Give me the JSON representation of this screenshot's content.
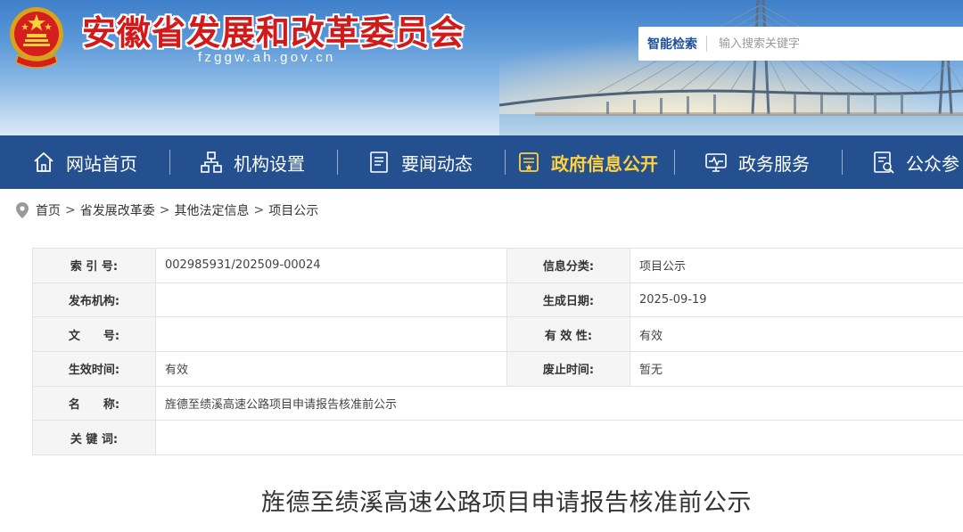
{
  "header": {
    "site_title": "安徽省发展和改革委员会",
    "site_domain": "fzggw.ah.gov.cn",
    "emblem_icon": "national-emblem-icon",
    "search": {
      "label": "智能检索",
      "placeholder": "输入搜索关键字"
    }
  },
  "nav": {
    "items": [
      {
        "label": "网站首页",
        "icon": "home-icon",
        "active": false
      },
      {
        "label": "机构设置",
        "icon": "org-chart-icon",
        "active": false
      },
      {
        "label": "要闻动态",
        "icon": "news-icon",
        "active": false
      },
      {
        "label": "政府信息公开",
        "icon": "info-disclosure-icon",
        "active": true
      },
      {
        "label": "政务服务",
        "icon": "service-icon",
        "active": false
      },
      {
        "label": "公众参",
        "icon": "public-participation-icon",
        "active": false
      }
    ]
  },
  "breadcrumb": {
    "items": [
      "首页",
      "省发展改革委",
      "其他法定信息",
      "项目公示"
    ],
    "separator": ">"
  },
  "meta_table": {
    "index_label": "索 引 号:",
    "index_value": "002985931/202509-00024",
    "category_label": "信息分类:",
    "category_value": "项目公示",
    "publisher_label": "发布机构:",
    "publisher_value": "",
    "date_label": "生成日期:",
    "date_value": "2025-09-19",
    "docno_label": "文　　号:",
    "docno_value": "",
    "validity_label": "有 效 性:",
    "validity_value": "有效",
    "effective_label": "生效时间:",
    "effective_value": "有效",
    "repeal_label": "废止时间:",
    "repeal_value": "暂无",
    "name_label": "名　　称:",
    "name_value": "旌德至绩溪高速公路项目申请报告核准前公示",
    "keywords_label": "关 键 词:",
    "keywords_value": ""
  },
  "article": {
    "title": "旌德至绩溪高速公路项目申请报告核准前公示"
  },
  "colors": {
    "nav_bg": "#24508f",
    "nav_active": "#ffd23f",
    "title_red": "#d21a1a",
    "table_label_bg": "#f5f5f5"
  }
}
